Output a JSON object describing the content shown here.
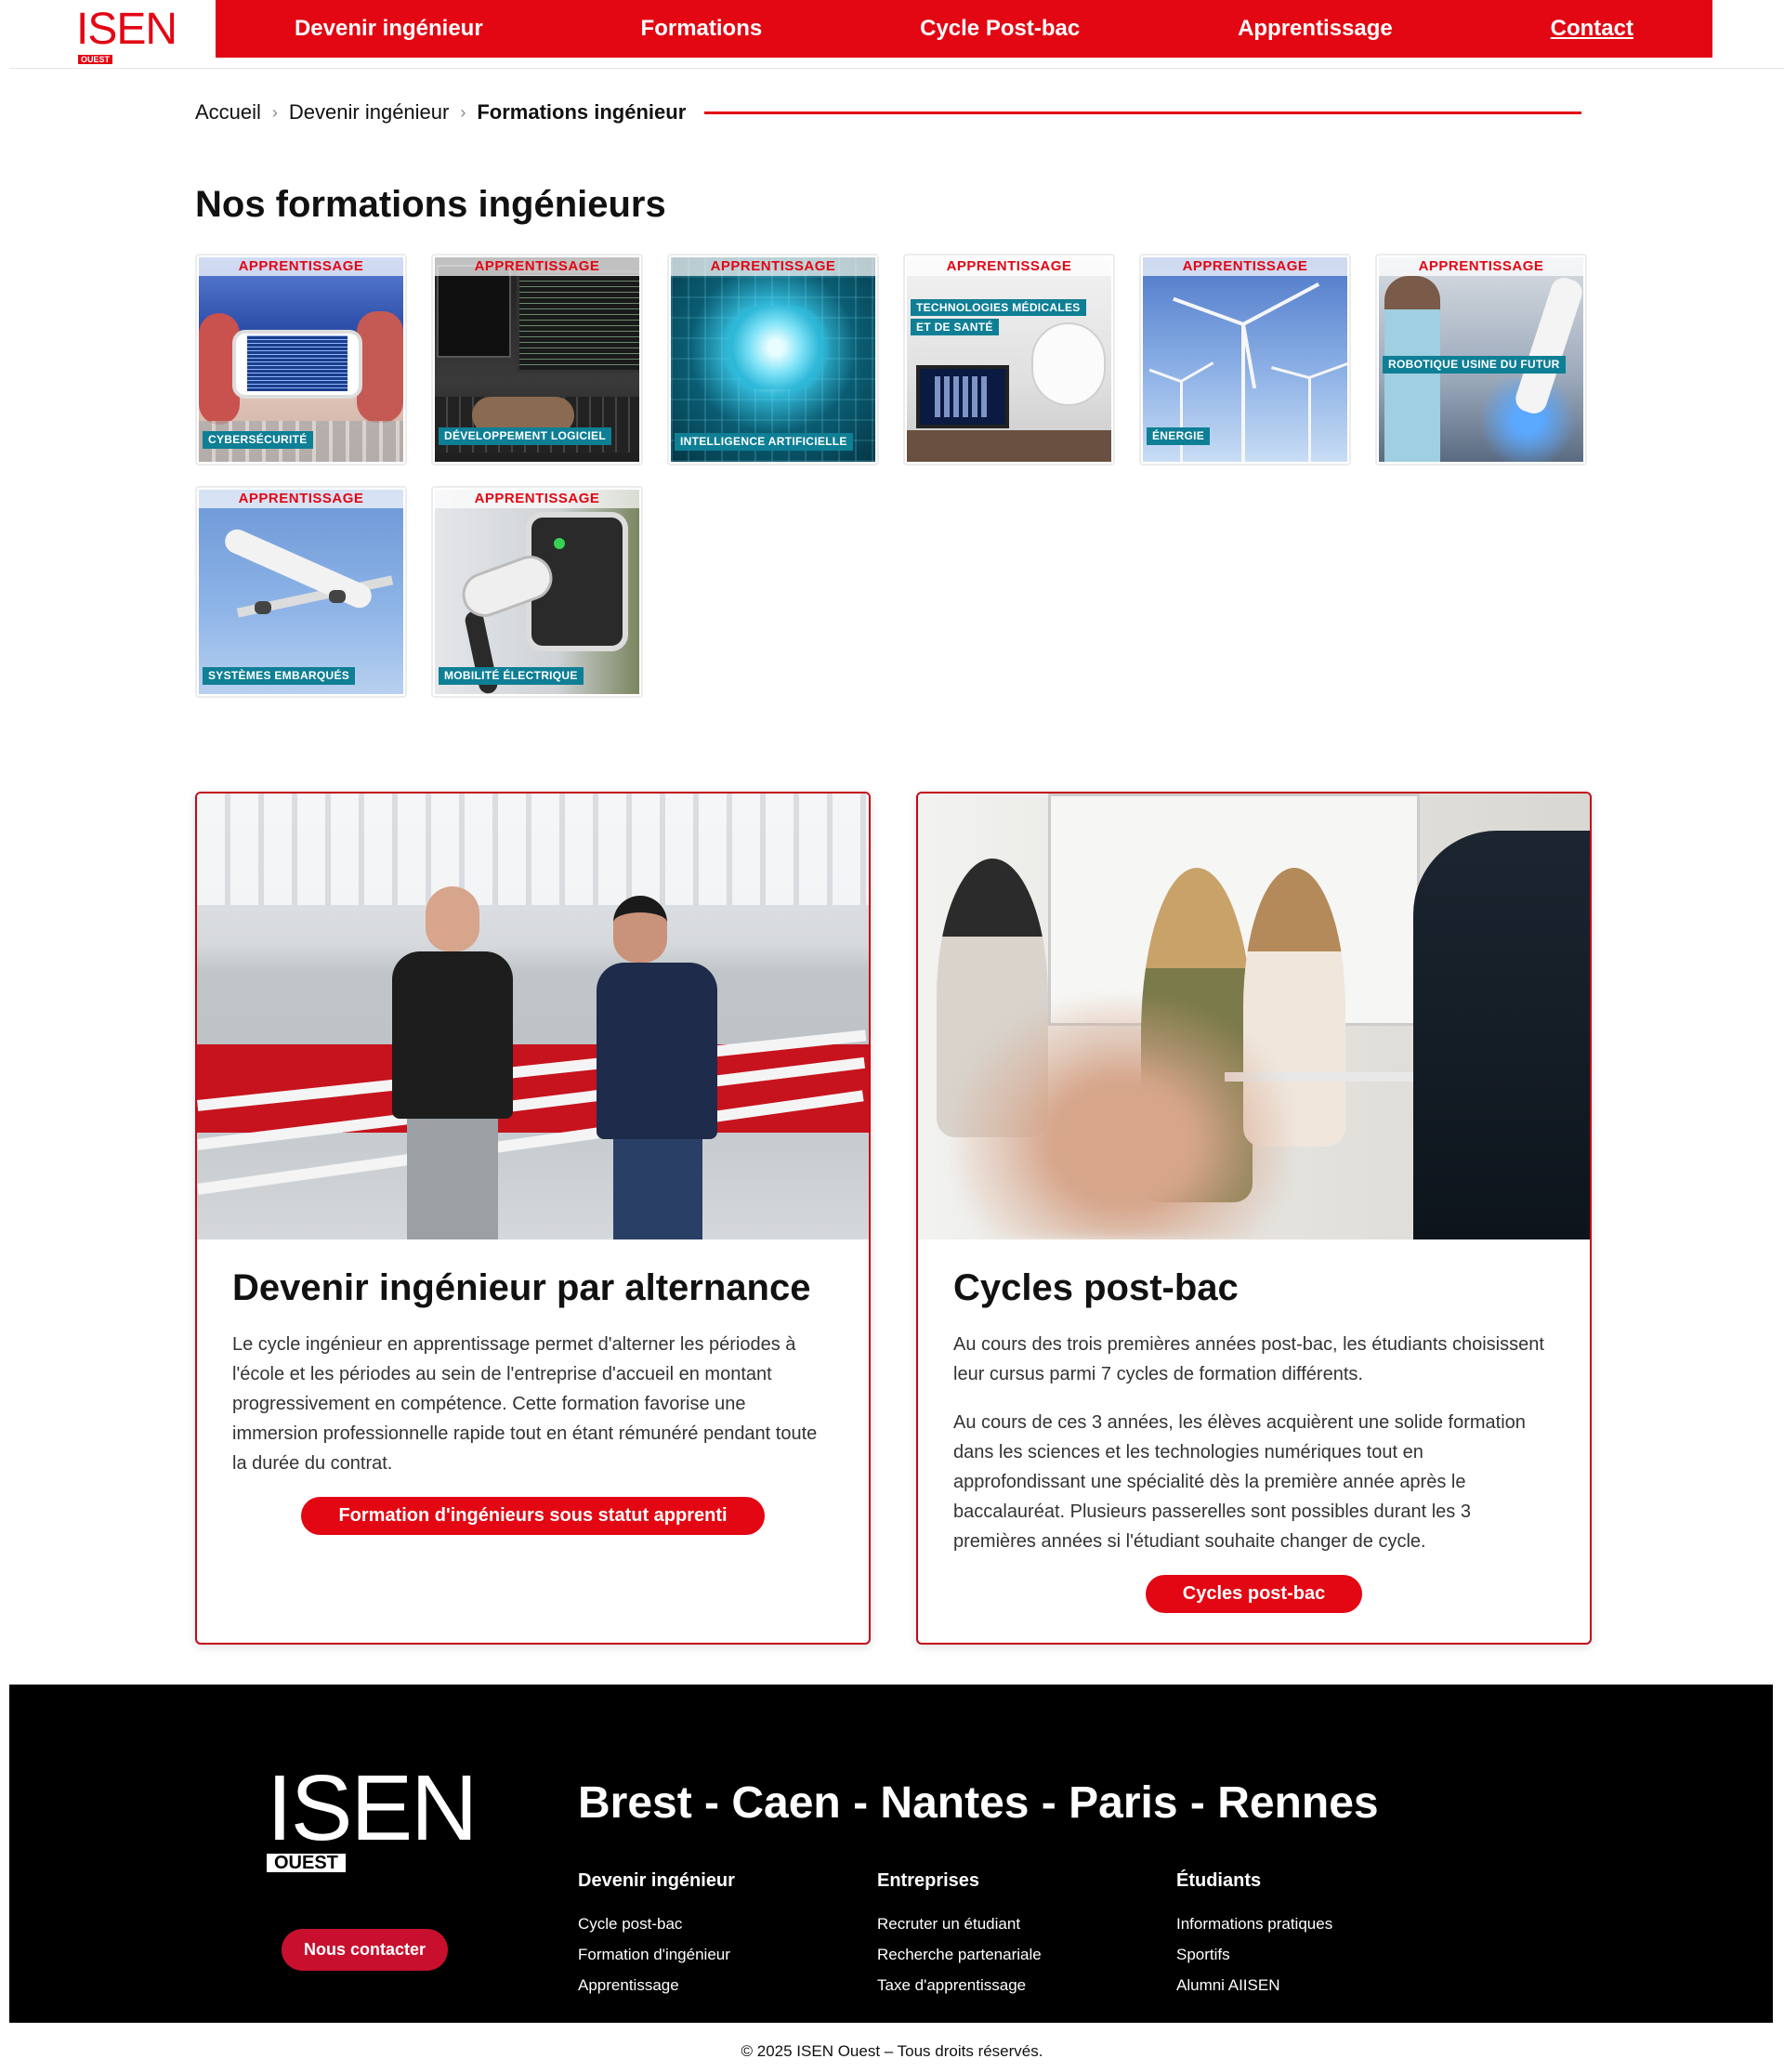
{
  "brand": {
    "logo_text": "ISEN",
    "logo_sub": "OUEST",
    "accent": "#e30613"
  },
  "nav": {
    "items": [
      {
        "label": "Devenir ingénieur"
      },
      {
        "label": "Formations"
      },
      {
        "label": "Cycle Post-bac"
      },
      {
        "label": "Apprentissage"
      },
      {
        "label": "Contact"
      }
    ]
  },
  "breadcrumb": {
    "items": [
      "Accueil",
      "Devenir ingénieur"
    ],
    "current": "Formations ingénieur",
    "separator": "›"
  },
  "page_title": "Nos formations ingénieurs",
  "tiles": [
    {
      "tag": "APPRENTISSAGE",
      "label": "CYBERSÉCURITÉ",
      "image": "phone-code-illustration"
    },
    {
      "tag": "APPRENTISSAGE",
      "label": "DÉVELOPPEMENT LOGICIEL",
      "image": "developer-workstation-illustration"
    },
    {
      "tag": "APPRENTISSAGE",
      "label": "INTELLIGENCE ARTIFICIELLE",
      "image": "digital-brain-illustration"
    },
    {
      "tag": "APPRENTISSAGE",
      "label": "TECHNOLOGIES MÉDICALES ET DE SANTÉ",
      "image": "medical-scanner-illustration"
    },
    {
      "tag": "APPRENTISSAGE",
      "label": "ÉNERGIE",
      "image": "wind-turbines-illustration"
    },
    {
      "tag": "APPRENTISSAGE",
      "label": "ROBOTIQUE USINE DU FUTUR",
      "image": "robot-arm-illustration"
    },
    {
      "tag": "APPRENTISSAGE",
      "label": "SYSTÈMES EMBARQUÉS",
      "image": "airplane-illustration"
    },
    {
      "tag": "APPRENTISSAGE",
      "label": "MOBILITÉ ÉLECTRIQUE",
      "image": "ev-charger-illustration"
    }
  ],
  "cards": [
    {
      "title": "Devenir ingénieur par alternance",
      "paragraphs": [
        "Le cycle ingénieur en apprentissage permet d'alterner les périodes à l'école et les périodes au sein de l'entreprise d'accueil en montant progressivement en compétence. Cette formation favorise une immersion professionnelle rapide tout en étant rémunéré pendant toute la durée du contrat."
      ],
      "button": "Formation d'ingénieurs sous statut apprenti"
    },
    {
      "title": "Cycles post-bac",
      "paragraphs": [
        "Au cours des trois premières années post-bac, les étudiants choisissent leur cursus parmi 7 cycles de formation différents.",
        "Au cours de ces 3 années, les élèves acquièrent une solide formation dans les sciences et les technologies numériques tout en approfondissant une spécialité dès la première année après le baccalauréat. Plusieurs passerelles sont possibles durant les 3 premières années si l'étudiant souhaite changer de cycle."
      ],
      "button": "Cycles post-bac"
    }
  ],
  "footer": {
    "logo_text": "ISEN",
    "logo_sub": "OUEST",
    "contact_button": "Nous contacter",
    "cities": "Brest - Caen - Nantes - Paris - Rennes",
    "columns": [
      {
        "title": "Devenir ingénieur",
        "links": [
          "Cycle post-bac",
          "Formation d'ingénieur",
          "Apprentissage"
        ]
      },
      {
        "title": "Entreprises",
        "links": [
          "Recruter un étudiant",
          "Recherche partenariale",
          "Taxe d'apprentissage"
        ]
      },
      {
        "title": "Étudiants",
        "links": [
          "Informations pratiques",
          "Sportifs",
          "Alumni AIISEN"
        ]
      }
    ]
  },
  "copyright": "© 2025 ISEN Ouest – Tous droits réservés."
}
